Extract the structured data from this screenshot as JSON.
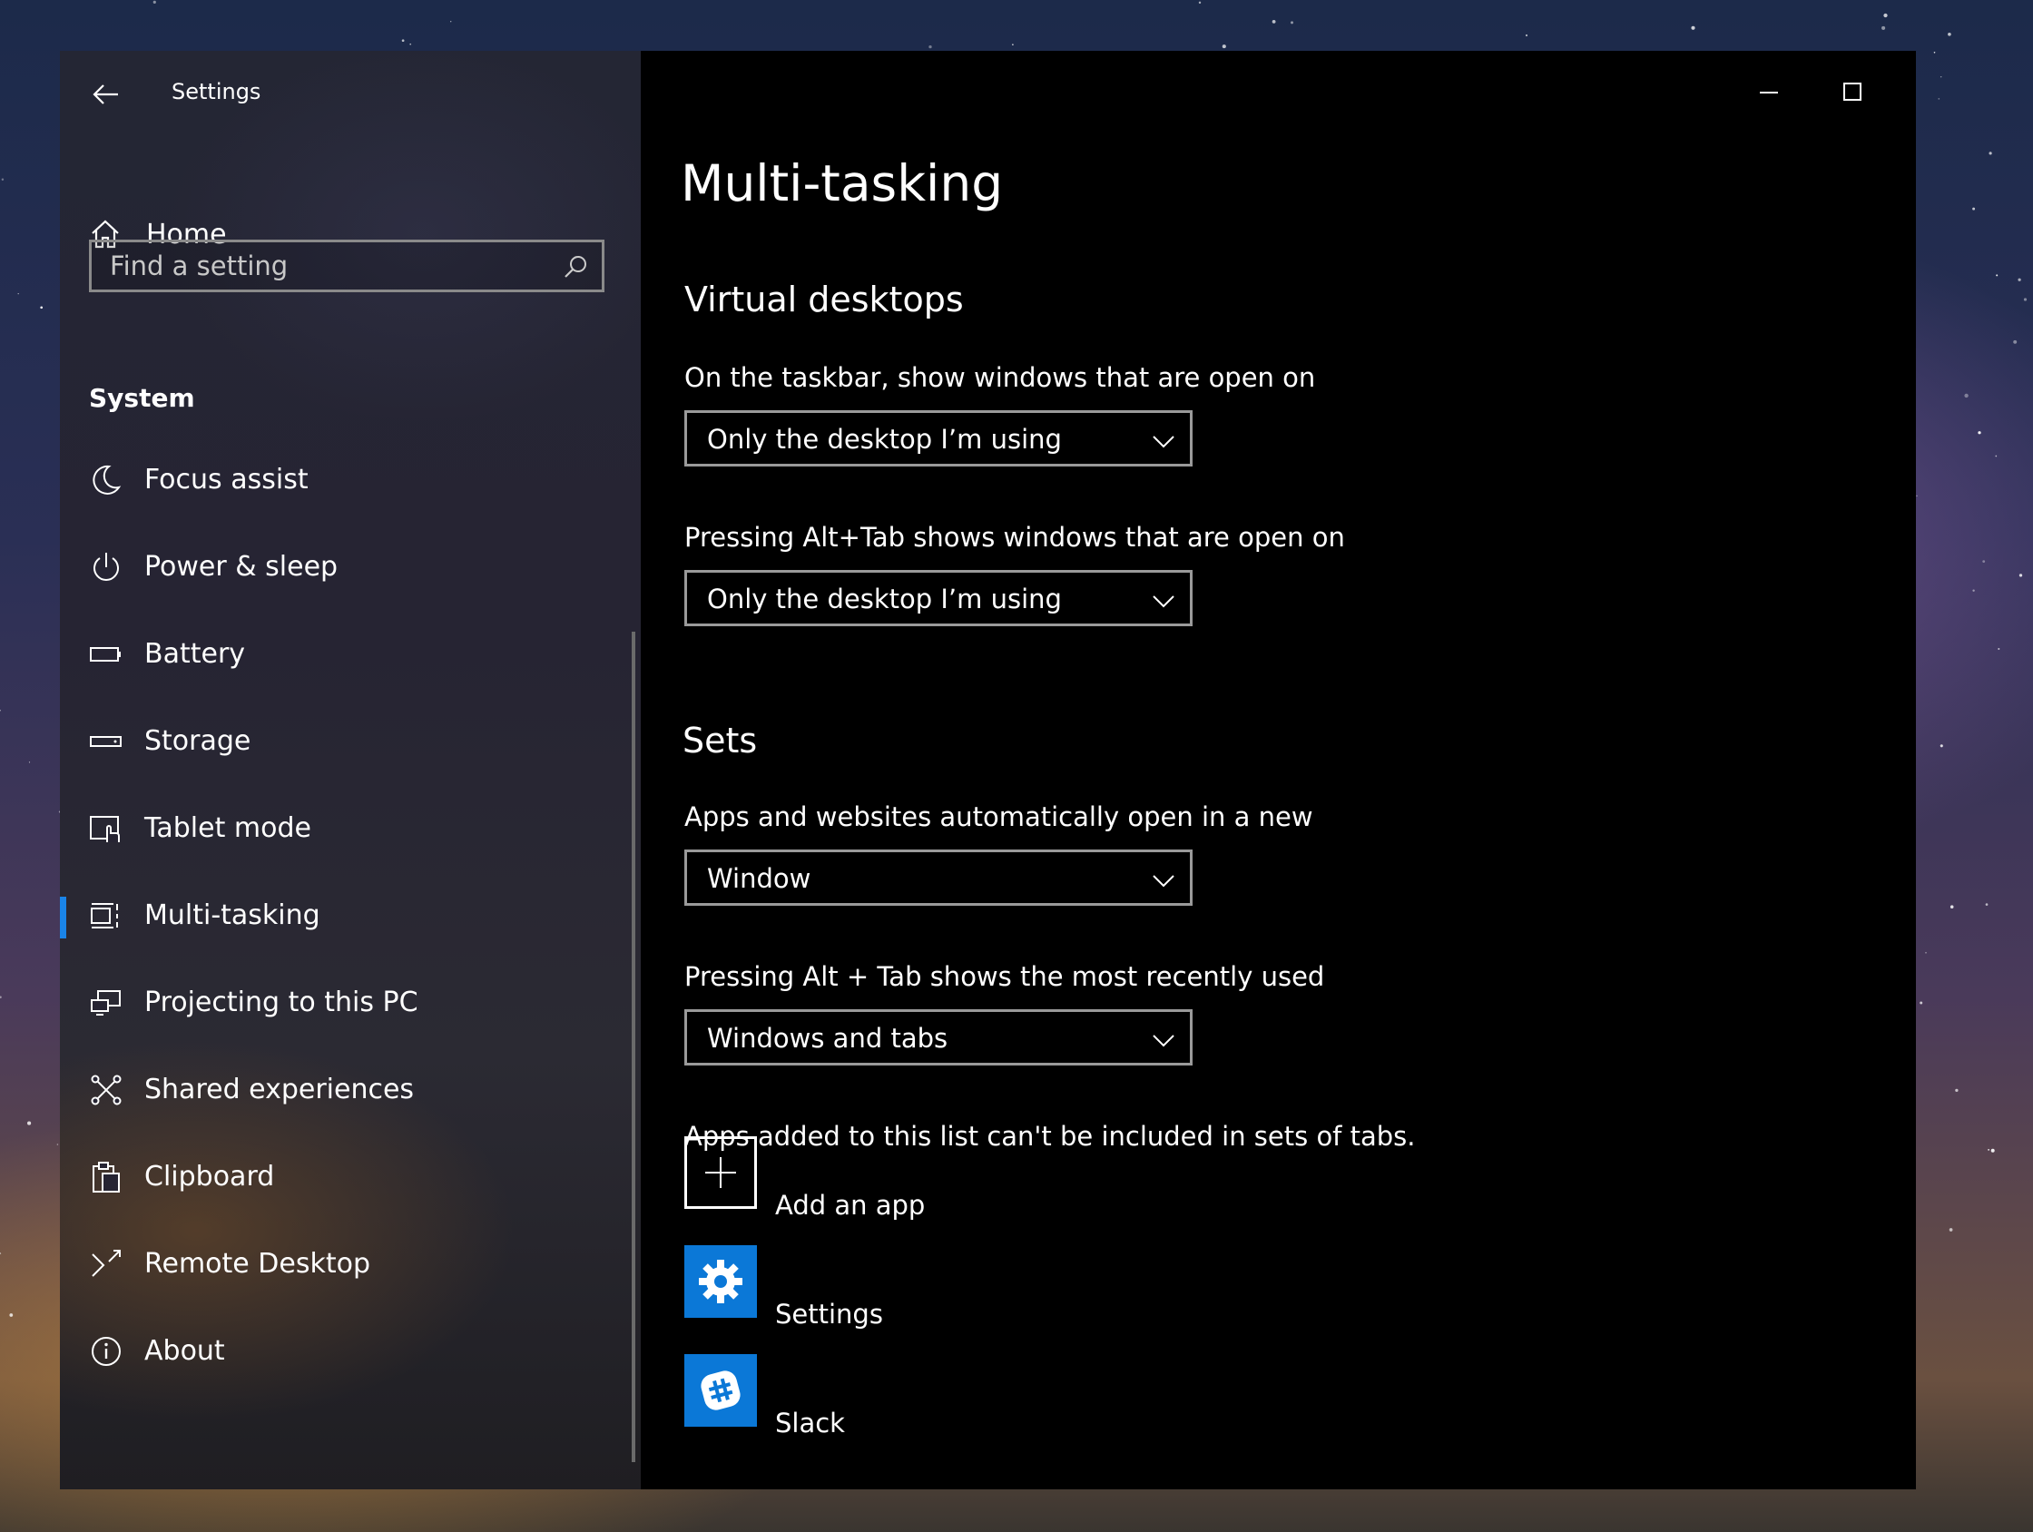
{
  "window": {
    "title": "Settings"
  },
  "sidebar": {
    "home_label": "Home",
    "search_placeholder": "Find a setting",
    "section_title": "System",
    "items": [
      {
        "label": "Focus assist",
        "icon": "moon-icon"
      },
      {
        "label": "Power & sleep",
        "icon": "power-icon"
      },
      {
        "label": "Battery",
        "icon": "battery-icon"
      },
      {
        "label": "Storage",
        "icon": "storage-icon"
      },
      {
        "label": "Tablet mode",
        "icon": "tablet-mode-icon"
      },
      {
        "label": "Multi-tasking",
        "icon": "multitasking-icon",
        "selected": true
      },
      {
        "label": "Projecting to this PC",
        "icon": "projecting-icon"
      },
      {
        "label": "Shared experiences",
        "icon": "shared-experiences-icon"
      },
      {
        "label": "Clipboard",
        "icon": "clipboard-icon"
      },
      {
        "label": "Remote Desktop",
        "icon": "remote-desktop-icon"
      },
      {
        "label": "About",
        "icon": "info-icon"
      }
    ]
  },
  "main": {
    "page_title": "Multi-tasking",
    "virtual_desktops": {
      "heading": "Virtual desktops",
      "taskbar_label": "On the taskbar, show windows that are open on",
      "taskbar_value": "Only the desktop I’m using",
      "alttab_label": "Pressing Alt+Tab shows windows that are open on",
      "alttab_value": "Only the desktop I’m using"
    },
    "sets": {
      "heading": "Sets",
      "open_label": "Apps and websites automatically open in a new",
      "open_value": "Window",
      "recent_label": "Pressing Alt + Tab shows the most recently used",
      "recent_value": "Windows and tabs",
      "exclusion_label": "Apps added to this list can't be included in sets of tabs.",
      "add_app_label": "Add an app",
      "apps": [
        {
          "name": "Settings",
          "icon": "settings-gear-icon"
        },
        {
          "name": "Slack",
          "icon": "slack-icon"
        }
      ]
    }
  },
  "colors": {
    "accent": "#1a84e8",
    "app_tile": "#0b78d7",
    "window_bg": "#000000"
  }
}
